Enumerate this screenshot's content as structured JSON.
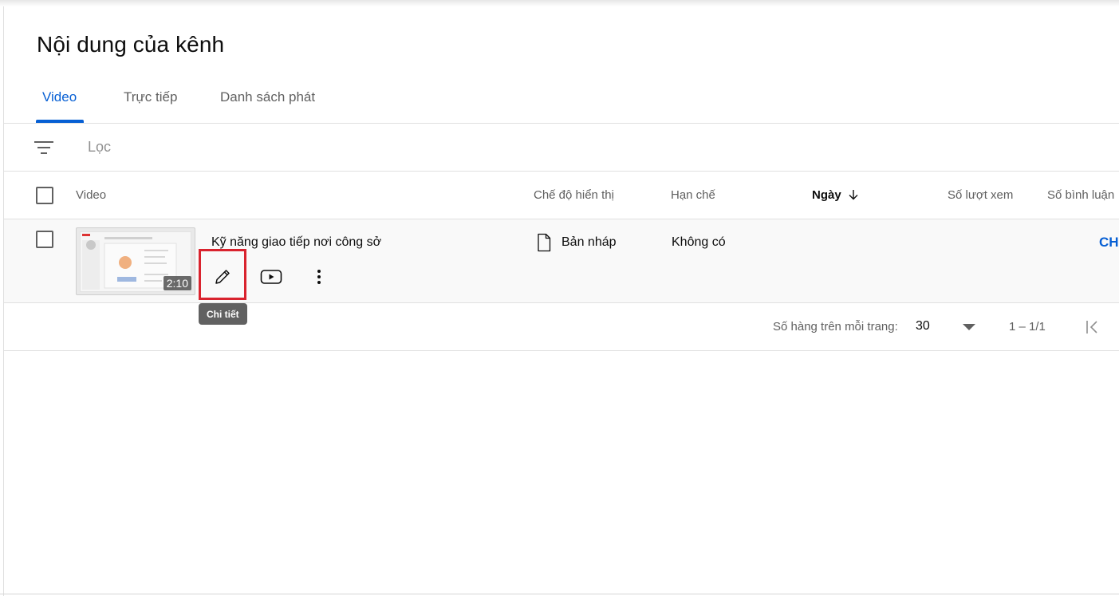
{
  "page": {
    "title": "Nội dung của kênh"
  },
  "tabs": [
    {
      "label": "Video",
      "active": true
    },
    {
      "label": "Trực tiếp",
      "active": false
    },
    {
      "label": "Danh sách phát",
      "active": false
    }
  ],
  "filter": {
    "placeholder": "Lọc",
    "icon": "filter-icon"
  },
  "table": {
    "headers": {
      "video": "Video",
      "visibility": "Chế độ hiển thị",
      "restrictions": "Hạn chế",
      "date": "Ngày",
      "views": "Số lượt xem",
      "comments": "Số bình luận"
    },
    "rows": [
      {
        "title": "Kỹ năng giao tiếp nơi công sở",
        "duration": "2:10",
        "visibility": "Bản nháp",
        "restrictions": "Không có",
        "action_link": "CH"
      }
    ]
  },
  "tooltip": {
    "text": "Chi tiết"
  },
  "pagination": {
    "rows_per_page_label": "Số hàng trên mỗi trang:",
    "rows_per_page_value": "30",
    "range": "1 – 1/1"
  },
  "colors": {
    "accent": "#065fd4",
    "highlight": "#d9232e",
    "tooltip_bg": "#616161"
  }
}
